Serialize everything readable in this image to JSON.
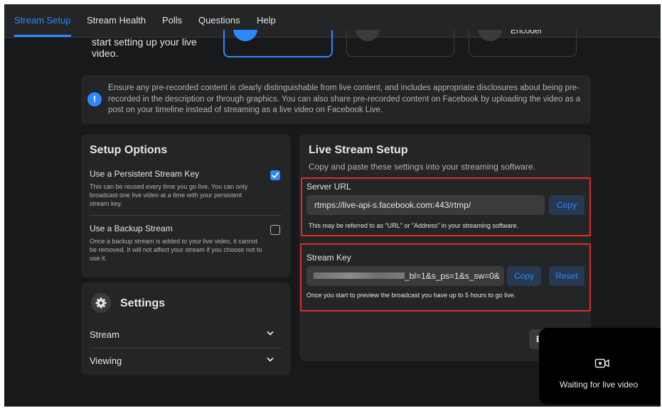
{
  "nav": {
    "tabs": [
      {
        "label": "Stream Setup"
      },
      {
        "label": "Stream Health"
      },
      {
        "label": "Polls"
      },
      {
        "label": "Questions"
      },
      {
        "label": "Help"
      }
    ]
  },
  "top": {
    "intro_text": "start setting up your live video.",
    "option3_label": "Encoder"
  },
  "notice": {
    "text": "Ensure any pre-recorded content is clearly distinguishable from live content, and includes appropriate disclosures about being pre-recorded in the description or through graphics. You can also share pre-recorded content on Facebook by uploading the video as a post on your timeline instead of streaming as a live video on Facebook Live."
  },
  "setup_options": {
    "title": "Setup Options",
    "persistent": {
      "label": "Use a Persistent Stream Key",
      "description": "This can be reused every time you go live. You can only broadcast one live video at a time with your persistent stream key.",
      "checked": true
    },
    "backup": {
      "label": "Use a Backup Stream",
      "description": "Once a backup stream is added to your live video, it cannot be removed. It will not affect your stream if you choose not to use it.",
      "checked": false
    }
  },
  "settings": {
    "title": "Settings",
    "items": [
      {
        "label": "Stream"
      },
      {
        "label": "Viewing"
      }
    ]
  },
  "live_setup": {
    "title": "Live Stream Setup",
    "subtitle": "Copy and paste these settings into your streaming software.",
    "server_url": {
      "label": "Server URL",
      "value": "rtmps://live-api-s.facebook.com:443/rtmp/",
      "copy_label": "Copy",
      "hint": "This may be referred to as \"URL\" or \"Address\" in your streaming software."
    },
    "stream_key": {
      "label": "Stream Key",
      "value_visible": "_bl=1&s_ps=1&s_sw=0&",
      "copy_label": "Copy",
      "reset_label": "Reset",
      "hint": "Once you start to preview the broadcast you have up to 5 hours to go live."
    },
    "partial_button": "E"
  },
  "preview": {
    "status": "Waiting for live video"
  },
  "colors": {
    "accent": "#2d88ff",
    "highlight_border": "#e02b2b",
    "panel": "#242526",
    "background": "#18191a"
  }
}
